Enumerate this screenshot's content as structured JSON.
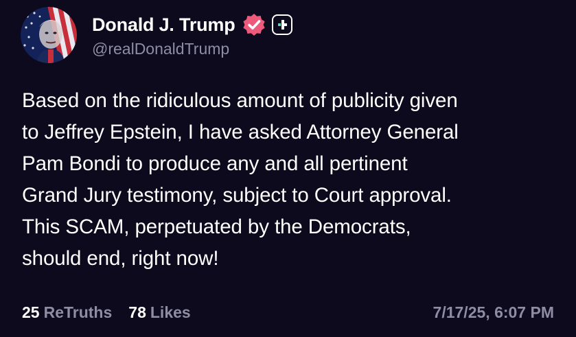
{
  "author": {
    "display_name": "Donald J. Trump",
    "handle": "@realDonaldTrump",
    "avatar_icon": "profile-avatar-flag",
    "verified_icon": "verified-badge-icon",
    "follow_icon": "add-follow-icon"
  },
  "post": {
    "text": "Based on the ridiculous amount of publicity given\nto Jeffrey Epstein, I have asked Attorney General\nPam Bondi to produce any and all pertinent\nGrand Jury testimony, subject to Court approval.\nThis SCAM, perpetuated by the Democrats,\nshould end, right now!",
    "retruths_count": "25",
    "retruths_label": "ReTruths",
    "likes_count": "78",
    "likes_label": "Likes",
    "timestamp": "7/17/25, 6:07 PM"
  },
  "colors": {
    "background": "#0c0a1c",
    "text_primary": "#ffffff",
    "text_secondary": "#8f8da3",
    "verified_badge": "#ee5a7c",
    "follow_plus_accent": "#57d3b6"
  }
}
